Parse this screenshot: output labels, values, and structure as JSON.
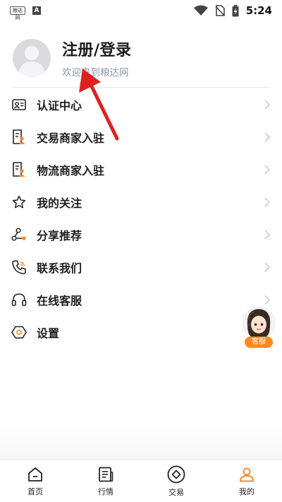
{
  "status_bar": {
    "time": "5:24",
    "left_icons": [
      "app-logo-icon",
      "a-notification-icon"
    ],
    "app_logo_text": "粮达网",
    "a_text": "A",
    "right_icons": [
      "wifi-icon",
      "no-sim-icon",
      "battery-charging-icon"
    ]
  },
  "profile": {
    "title": "注册/登录",
    "subtitle": "欢迎来到粮达网"
  },
  "menu": {
    "items": [
      {
        "label": "认证中心",
        "icon": "id-card-icon"
      },
      {
        "label": "交易商家入驻",
        "icon": "merchant-doc-icon"
      },
      {
        "label": "物流商家入驻",
        "icon": "merchant-doc-icon"
      },
      {
        "label": "我的关注",
        "icon": "star-icon"
      },
      {
        "label": "分享推荐",
        "icon": "share-icon"
      },
      {
        "label": "联系我们",
        "icon": "phone-icon"
      },
      {
        "label": "在线客服",
        "icon": "headset-icon"
      },
      {
        "label": "设置",
        "icon": "settings-hexagon-icon"
      }
    ]
  },
  "customer_service_float": {
    "label": "客服"
  },
  "tabbar": {
    "tabs": [
      {
        "label": "首页",
        "icon": "home-icon"
      },
      {
        "label": "行情",
        "icon": "news-icon"
      },
      {
        "label": "交易",
        "icon": "trade-target-icon"
      },
      {
        "label": "我的",
        "icon": "user-icon",
        "active": true
      }
    ]
  },
  "colors": {
    "accent": "#ff8a1e",
    "annotation_arrow": "#e02020",
    "text_primary": "#1f1f1f",
    "text_secondary": "#8f97a8"
  }
}
